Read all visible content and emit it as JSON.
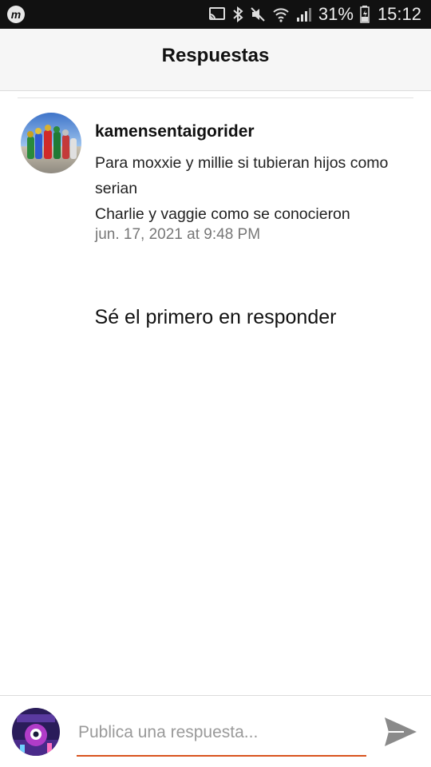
{
  "status_bar": {
    "app_icon": "m-logo-icon",
    "battery_percent": "31%",
    "time": "15:12",
    "icons": [
      "cast-icon",
      "bluetooth-icon",
      "mute-icon",
      "wifi-icon",
      "signal-icon",
      "battery-charging-icon"
    ]
  },
  "header": {
    "title": "Respuestas"
  },
  "comment": {
    "author": "kamensentaigorider",
    "lines": [
      "Para moxxie y millie si tubieran hijos como serian",
      "Charlie y vaggie como se conocieron"
    ],
    "date": "jun. 17, 2021 at 9:48 PM"
  },
  "empty_state": {
    "message": "Sé el primero en responder"
  },
  "composer": {
    "placeholder": "Publica una respuesta...",
    "send_icon": "send-icon"
  },
  "colors": {
    "accent": "#d9531e",
    "header_bg": "#f6f6f6",
    "status_bg": "#111111"
  }
}
